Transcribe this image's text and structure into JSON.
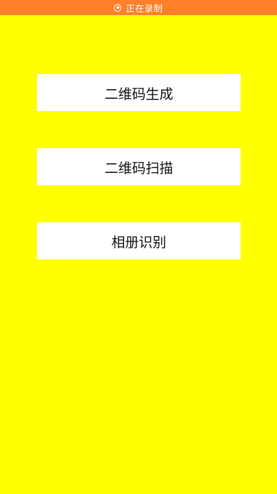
{
  "status_bar": {
    "icon": "record-icon",
    "label": "正在录制",
    "color": "#ff7f2a"
  },
  "page": {
    "background": "#ffff00"
  },
  "menu": {
    "buttons": [
      {
        "label": "二维码生成"
      },
      {
        "label": "二维码扫描"
      },
      {
        "label": "相册识别"
      }
    ]
  }
}
